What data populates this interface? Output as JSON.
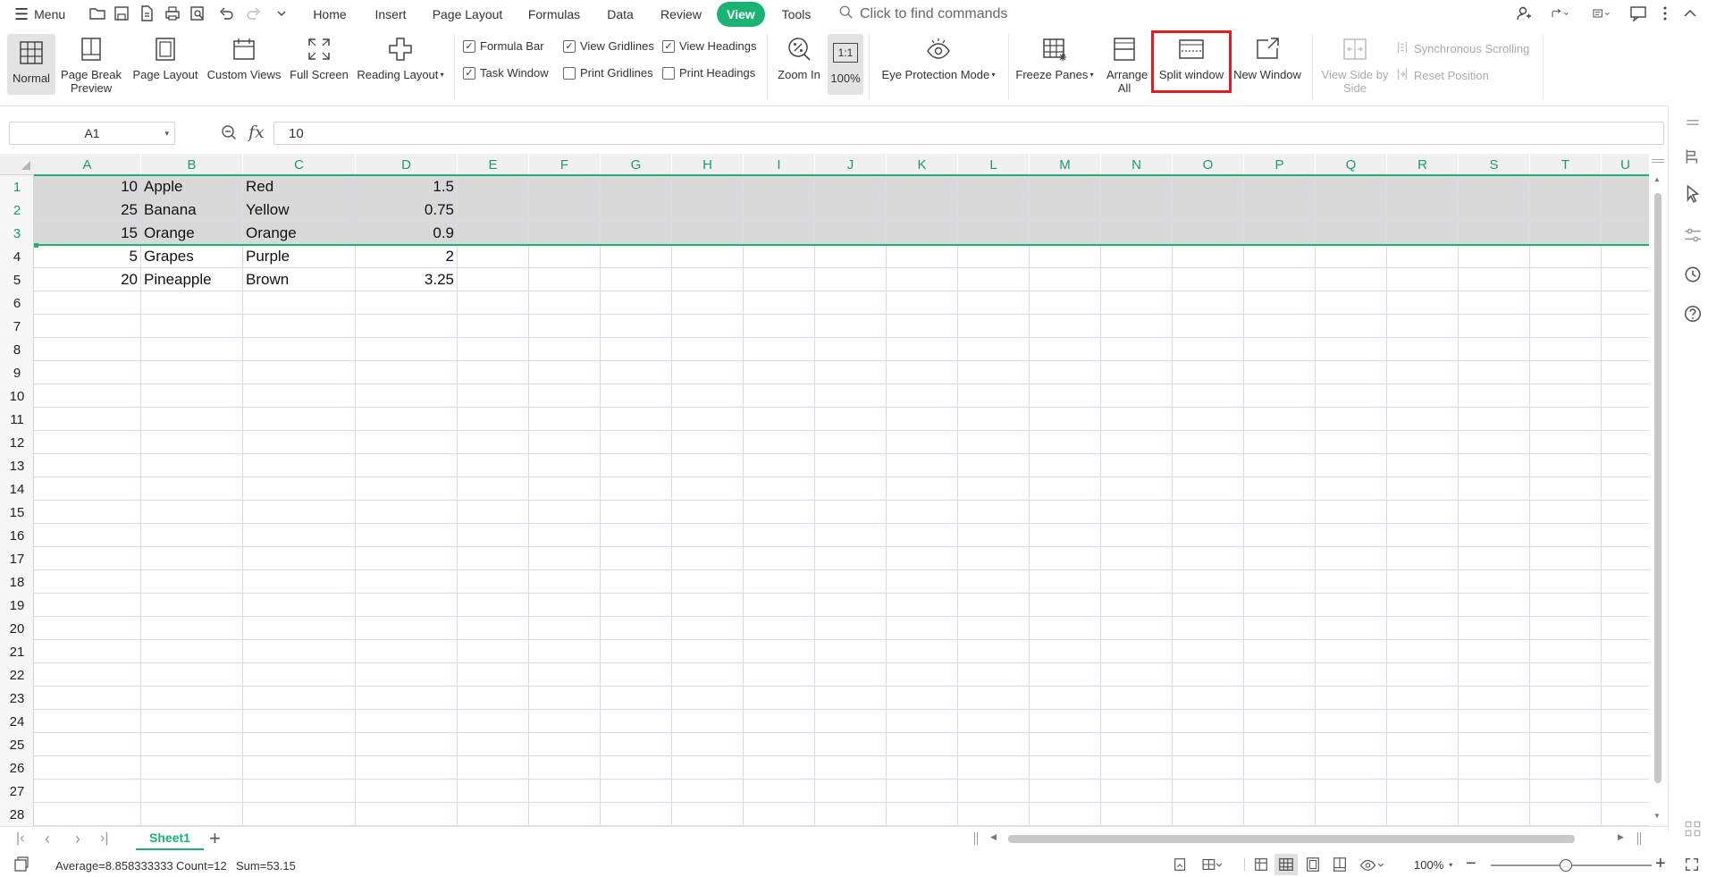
{
  "toolbar": {
    "menu_label": "Menu",
    "tabs": [
      "Home",
      "Insert",
      "Page Layout",
      "Formulas",
      "Data",
      "Review",
      "View",
      "Tools"
    ],
    "active_tab": "View",
    "search_placeholder": "Click to find commands"
  },
  "ribbon": {
    "normal": "Normal",
    "page_break_preview": "Page Break Preview",
    "page_layout": "Page Layout",
    "custom_views": "Custom Views",
    "full_screen": "Full Screen",
    "reading_layout": "Reading Layout",
    "formula_bar": "Formula Bar",
    "view_gridlines": "View Gridlines",
    "view_headings": "View Headings",
    "task_window": "Task Window",
    "print_gridlines": "Print Gridlines",
    "print_headings": "Print Headings",
    "zoom_in": "Zoom In",
    "zoom_100": "100%",
    "eye_protection": "Eye Protection Mode",
    "freeze_panes": "Freeze Panes",
    "arrange_all": "Arrange All",
    "split_window": "Split window",
    "new_window": "New Window",
    "view_side_by_side": "View Side by Side",
    "synchronous_scrolling": "Synchronous Scrolling",
    "reset_position": "Reset Position",
    "zoom_100_glyph": "1:1"
  },
  "formula_bar": {
    "name_box": "A1",
    "fx": "fx",
    "value": "10"
  },
  "columns": [
    "A",
    "B",
    "C",
    "D",
    "E",
    "F",
    "G",
    "H",
    "I",
    "J",
    "K",
    "L",
    "M",
    "N",
    "O",
    "P",
    "Q",
    "R",
    "S",
    "T",
    "U"
  ],
  "rows": [
    "1",
    "2",
    "3",
    "4",
    "5",
    "6",
    "7",
    "8",
    "9",
    "10",
    "11",
    "12",
    "13",
    "14",
    "15",
    "16",
    "17",
    "18",
    "19",
    "20",
    "21",
    "22",
    "23",
    "24",
    "25",
    "26",
    "27",
    "28"
  ],
  "cells": [
    [
      "10",
      "Apple",
      "Red",
      "1.5"
    ],
    [
      "25",
      "Banana",
      "Yellow",
      "0.75"
    ],
    [
      "15",
      "Orange",
      "Orange",
      "0.9"
    ],
    [
      "5",
      "Grapes",
      "Purple",
      "2"
    ],
    [
      "20",
      "Pineapple",
      "Brown",
      "3.25"
    ]
  ],
  "sheet_tabs": {
    "active": "Sheet1"
  },
  "status": {
    "average": "Average=8.858333333",
    "count": "Count=12",
    "sum": "Sum=53.15",
    "zoom": "100%"
  },
  "colors": {
    "accent": "#1bb374",
    "highlight": "#e31b23",
    "selection": "#d9d9d9"
  }
}
